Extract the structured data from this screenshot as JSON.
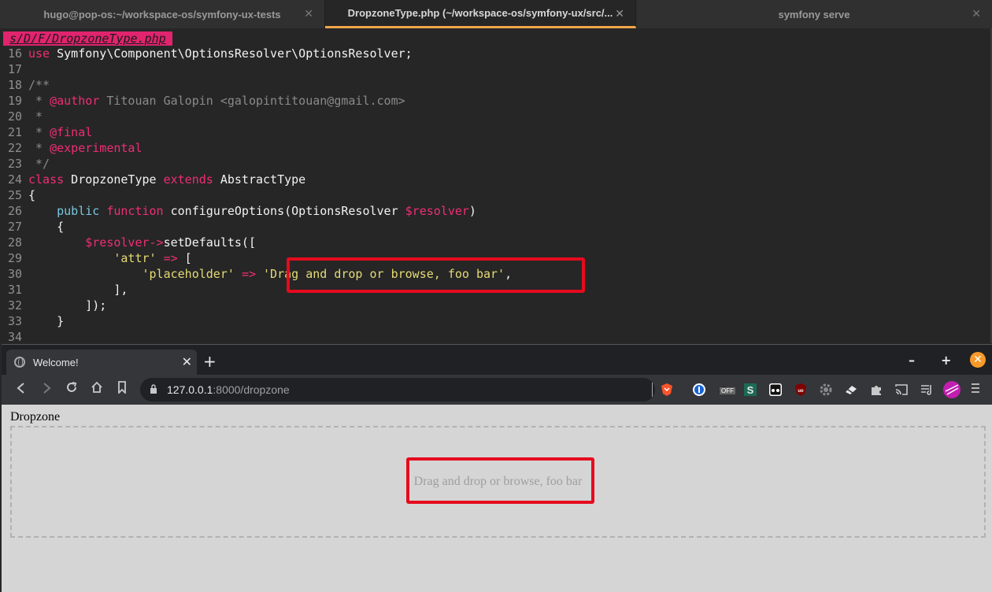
{
  "terminal": {
    "tabs": [
      {
        "label": "hugo@pop-os:~/workspace-os/symfony-ux-tests",
        "close": "✕",
        "active": false
      },
      {
        "label": "DropzoneType.php (~/workspace-os/symfony-ux/src/...",
        "close": "✕",
        "active": true
      },
      {
        "label": "symfony serve",
        "close": "✕",
        "active": false
      }
    ]
  },
  "editor": {
    "filename": "s/D/F/DropzoneType.php",
    "lines": [
      {
        "n": "16",
        "tokens": [
          {
            "t": "use",
            "c": "kw"
          },
          {
            "t": " Symfony\\Component\\OptionsResolver\\OptionsResolver;",
            "c": "fg"
          }
        ]
      },
      {
        "n": "17",
        "tokens": []
      },
      {
        "n": "18",
        "tokens": [
          {
            "t": "/**",
            "c": "cm"
          }
        ]
      },
      {
        "n": "19",
        "tokens": [
          {
            "t": " * ",
            "c": "cm"
          },
          {
            "t": "@author",
            "c": "tg"
          },
          {
            "t": " Titouan Galopin <galopintitouan@gmail.com>",
            "c": "cm"
          }
        ]
      },
      {
        "n": "20",
        "tokens": [
          {
            "t": " *",
            "c": "cm"
          }
        ]
      },
      {
        "n": "21",
        "tokens": [
          {
            "t": " * ",
            "c": "cm"
          },
          {
            "t": "@final",
            "c": "tg"
          }
        ]
      },
      {
        "n": "22",
        "tokens": [
          {
            "t": " * ",
            "c": "cm"
          },
          {
            "t": "@experimental",
            "c": "tg"
          }
        ]
      },
      {
        "n": "23",
        "tokens": [
          {
            "t": " */",
            "c": "cm"
          }
        ]
      },
      {
        "n": "24",
        "tokens": [
          {
            "t": "class",
            "c": "kw"
          },
          {
            "t": " DropzoneType ",
            "c": "fg"
          },
          {
            "t": "extends",
            "c": "kw"
          },
          {
            "t": " AbstractType",
            "c": "fg"
          }
        ]
      },
      {
        "n": "25",
        "tokens": [
          {
            "t": "{",
            "c": "fg"
          }
        ]
      },
      {
        "n": "26",
        "tokens": [
          {
            "t": "    ",
            "c": "fg"
          },
          {
            "t": "public",
            "c": "bl"
          },
          {
            "t": " ",
            "c": "fg"
          },
          {
            "t": "function",
            "c": "kw"
          },
          {
            "t": " configureOptions(OptionsResolver ",
            "c": "fg"
          },
          {
            "t": "$resolver",
            "c": "vr"
          },
          {
            "t": ")",
            "c": "fg"
          }
        ]
      },
      {
        "n": "27",
        "tokens": [
          {
            "t": "    {",
            "c": "fg"
          }
        ]
      },
      {
        "n": "28",
        "tokens": [
          {
            "t": "        ",
            "c": "fg"
          },
          {
            "t": "$resolver",
            "c": "vr"
          },
          {
            "t": "->",
            "c": "op"
          },
          {
            "t": "setDefaults([",
            "c": "fg"
          }
        ]
      },
      {
        "n": "29",
        "tokens": [
          {
            "t": "            ",
            "c": "fg"
          },
          {
            "t": "'attr'",
            "c": "st"
          },
          {
            "t": " ",
            "c": "fg"
          },
          {
            "t": "=>",
            "c": "op"
          },
          {
            "t": " [",
            "c": "fg"
          }
        ]
      },
      {
        "n": "30",
        "tokens": [
          {
            "t": "                ",
            "c": "fg"
          },
          {
            "t": "'placeholder'",
            "c": "st"
          },
          {
            "t": " ",
            "c": "fg"
          },
          {
            "t": "=>",
            "c": "op"
          },
          {
            "t": " ",
            "c": "fg"
          },
          {
            "t": "'Drag and drop or browse, foo bar'",
            "c": "st"
          },
          {
            "t": ",",
            "c": "fg"
          }
        ]
      },
      {
        "n": "31",
        "tokens": [
          {
            "t": "            ],",
            "c": "fg"
          }
        ]
      },
      {
        "n": "32",
        "tokens": [
          {
            "t": "        ]);",
            "c": "fg"
          }
        ]
      },
      {
        "n": "33",
        "tokens": [
          {
            "t": "    }",
            "c": "fg"
          }
        ]
      },
      {
        "n": "34",
        "tokens": []
      }
    ]
  },
  "browser": {
    "tab_title": "Welcome!",
    "tab_close": "✕",
    "new_tab": "+",
    "minimize": "–",
    "maximize": "+",
    "close": "✕",
    "url_host": "127.0.0.1",
    "url_rest": ":8000/dropzone",
    "ext_off_badge": "OFF",
    "accent_color": "#f89a2a",
    "page": {
      "label": "Dropzone",
      "placeholder": "Drag and drop or browse, foo bar"
    }
  }
}
